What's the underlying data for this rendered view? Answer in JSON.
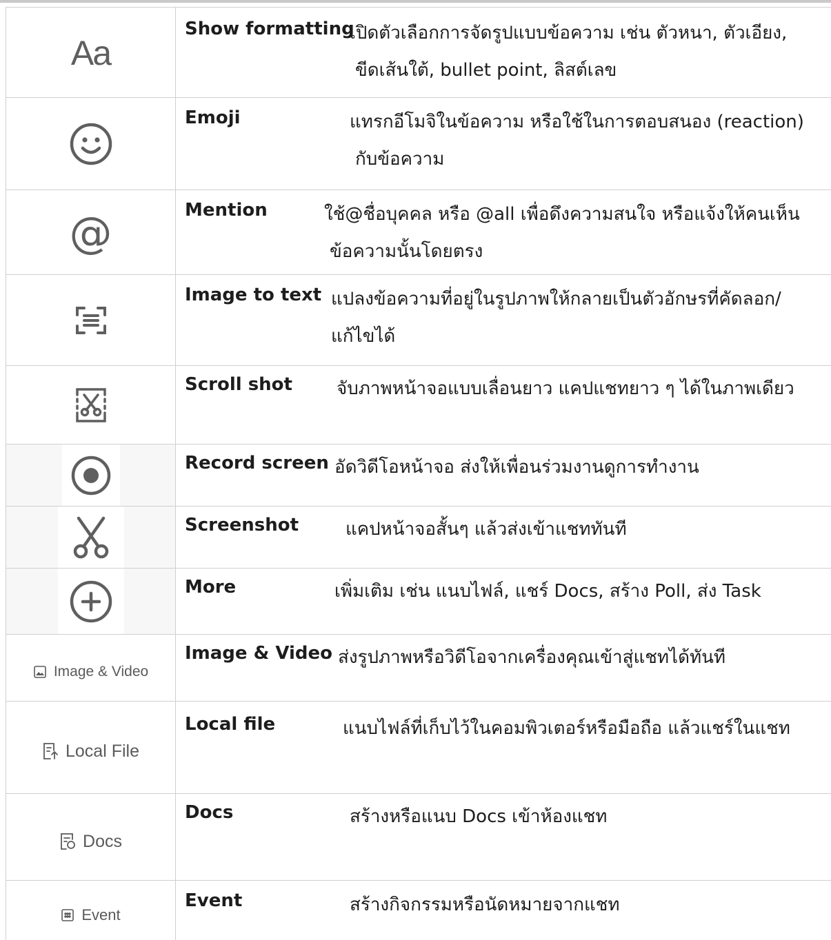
{
  "rows": [
    {
      "icon": "text-format-icon",
      "name": "Show formatting",
      "desc1": "เปิดตัวเลือกการจัดรูปแบบข้อความ เช่น ตัวหนา, ตัวเอียง,",
      "desc2": "ขีดเส้นใต้, bullet point, ลิสต์เลข",
      "glyph": "Aa"
    },
    {
      "icon": "emoji-icon",
      "name": "Emoji",
      "desc1": "แทรกอีโมจิในข้อความ หรือใช้ในการตอบสนอง (reaction)",
      "desc2": "กับข้อความ"
    },
    {
      "icon": "mention-icon",
      "name": "Mention",
      "desc1": "ใช้@ชื่อบุคคล หรือ @all เพื่อดึงความสนใจ หรือแจ้งให้คนเห็น",
      "desc2": "ข้อความนั้นโดยตรง",
      "glyph": "@"
    },
    {
      "icon": "image-to-text-icon",
      "name": "Image to text",
      "desc1": "แปลงข้อความที่อยู่ในรูปภาพให้กลายเป็นตัวอักษรที่คัดลอก/",
      "desc2": "แก้ไขได้"
    },
    {
      "icon": "scroll-shot-icon",
      "name": "Scroll shot",
      "desc1": "จับภาพหน้าจอแบบเลื่อนยาว แคปแชทยาว ๆ ได้ในภาพเดียว"
    },
    {
      "icon": "record-screen-icon",
      "name": "Record screen",
      "desc1": "อัดวิดีโอหน้าจอ ส่งให้เพื่อนร่วมงานดูการทำงาน"
    },
    {
      "icon": "scissors-icon",
      "name": "Screenshot",
      "desc1": "แคปหน้าจอสั้นๆ แล้วส่งเข้าแชททันที"
    },
    {
      "icon": "plus-circle-icon",
      "name": "More",
      "desc1": "เพิ่มเติม เช่น แนบไฟล์, แชร์ Docs, สร้าง Poll, ส่ง Task"
    },
    {
      "icon": "image-icon",
      "button": "Image & Video",
      "name": "Image & Video",
      "desc1": "ส่งรูปภาพหรือวิดีโอจากเครื่องคุณเข้าสู่แชทได้ทันที"
    },
    {
      "icon": "file-upload-icon",
      "button": "Local File",
      "name": "Local file",
      "desc1": "แนบไฟล์ที่เก็บไว้ในคอมพิวเตอร์หรือมือถือ แล้วแชร์ในแชท"
    },
    {
      "icon": "docs-icon",
      "button": "Docs",
      "name": "Docs",
      "desc1": "สร้างหรือแนบ Docs เข้าห้องแชท"
    },
    {
      "icon": "calendar-icon",
      "button": "Event",
      "name": "Event",
      "desc1": "สร้างกิจกรรมหรือนัดหมายจากแชท"
    }
  ],
  "colors": {
    "icon": "#5f5f5f",
    "border": "#cfcfcf",
    "text": "#1d1d1d"
  }
}
